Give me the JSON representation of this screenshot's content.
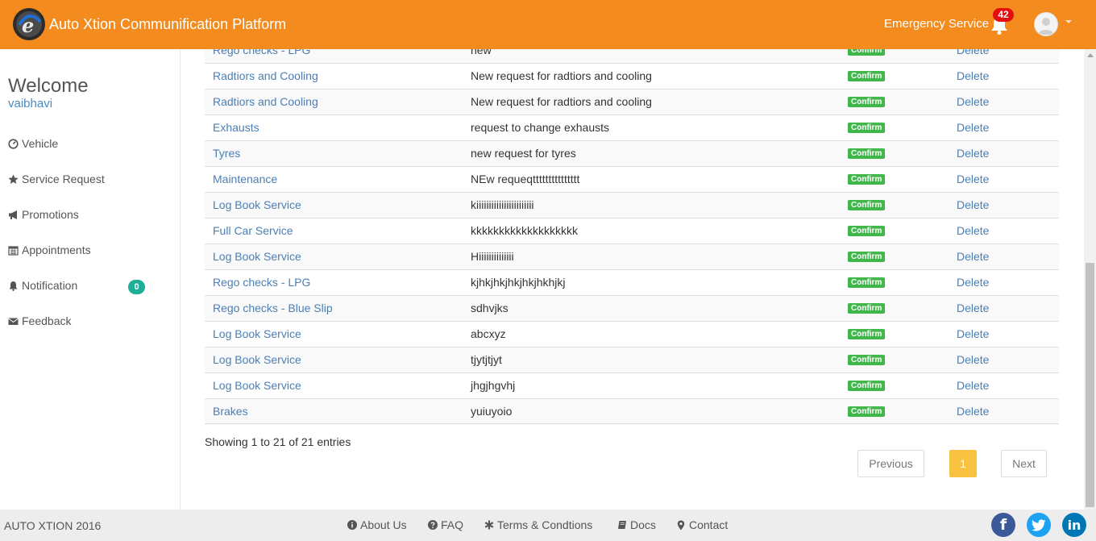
{
  "header": {
    "app_title": "Auto Xtion Communification Platform",
    "emergency_label": "Emergency Service",
    "notification_count": "42",
    "brand_color": "#f38b1f"
  },
  "sidebar": {
    "welcome": "Welcome",
    "username": "vaibhavi",
    "items": [
      {
        "label": "Vehicle",
        "icon": "speedometer-icon"
      },
      {
        "label": "Service Request",
        "icon": "star-icon"
      },
      {
        "label": "Promotions",
        "icon": "bullhorn-icon"
      },
      {
        "label": "Appointments",
        "icon": "calendar-icon"
      },
      {
        "label": "Notification",
        "icon": "bell-icon",
        "badge": "0"
      },
      {
        "label": "Feedback",
        "icon": "envelope-icon"
      }
    ]
  },
  "table": {
    "confirm_label": "Confirm",
    "delete_label": "Delete",
    "rows": [
      {
        "service": "Rego checks - LPG",
        "description": "new"
      },
      {
        "service": "Radtiors and Cooling",
        "description": "New request for radtiors and cooling"
      },
      {
        "service": "Radtiors and Cooling",
        "description": "New request for radtiors and cooling"
      },
      {
        "service": "Exhausts",
        "description": "request to change exhausts"
      },
      {
        "service": "Tyres",
        "description": "new request for tyres"
      },
      {
        "service": "Maintenance",
        "description": "NEw requeqttttttttttttttt"
      },
      {
        "service": "Log Book Service",
        "description": "kiiiiiiiiiiiiiiiiiiiiiii"
      },
      {
        "service": "Full Car Service",
        "description": "kkkkkkkkkkkkkkkkkkk"
      },
      {
        "service": "Log Book Service",
        "description": "Hiiiiiiiiiiiiii"
      },
      {
        "service": "Rego checks - LPG",
        "description": "kjhkjhkjhkjhkjhkhjkj"
      },
      {
        "service": "Rego checks - Blue Slip",
        "description": "sdhvjks"
      },
      {
        "service": "Log Book Service",
        "description": "abcxyz"
      },
      {
        "service": "Log Book Service",
        "description": "tjytjtjyt"
      },
      {
        "service": "Log Book Service",
        "description": "jhgjhgvhj"
      },
      {
        "service": "Brakes",
        "description": "yuiuyoio"
      }
    ]
  },
  "pagination": {
    "info": "Showing 1 to 21 of 21 entries",
    "previous": "Previous",
    "current": "1",
    "next": "Next"
  },
  "footer": {
    "copyright": "AUTO XTION 2016",
    "links": [
      {
        "label": "About Us",
        "icon": "info-circle-icon"
      },
      {
        "label": "FAQ",
        "icon": "question-circle-icon"
      },
      {
        "label": "Terms & Condtions",
        "icon": "asterisk-icon"
      },
      {
        "label": "Docs",
        "icon": "book-icon"
      },
      {
        "label": "Contact",
        "icon": "map-marker-icon"
      }
    ],
    "social": [
      {
        "name": "facebook",
        "color": "#3b5998",
        "glyph": "f"
      },
      {
        "name": "twitter",
        "color": "#1da1f2",
        "glyph": ""
      },
      {
        "name": "linkedin",
        "color": "#0077b5",
        "glyph": "in"
      }
    ]
  }
}
